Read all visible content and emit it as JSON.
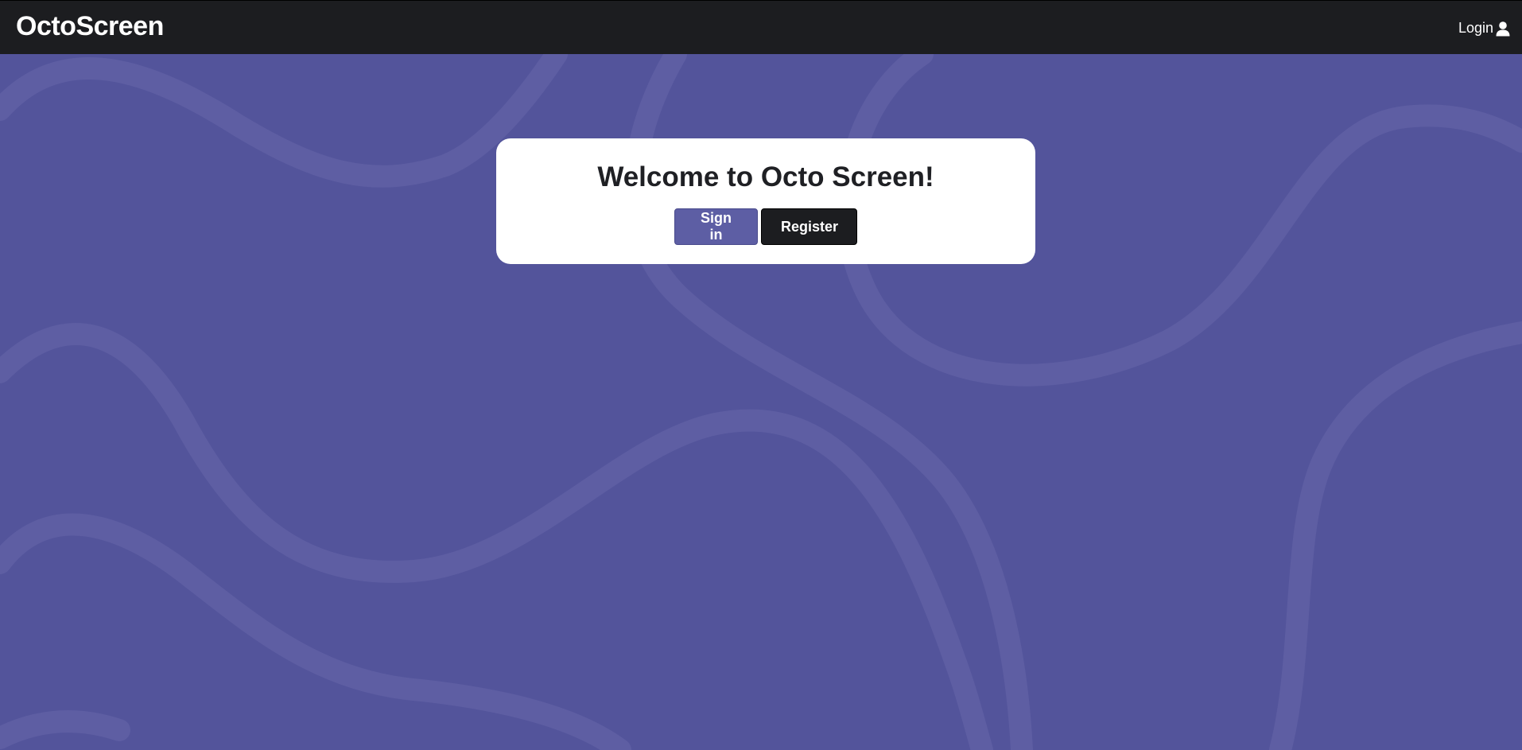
{
  "navbar": {
    "brand": "OctoScreen",
    "login_label": "Login",
    "login_icon": "user-icon"
  },
  "hero": {
    "background_color": "#53549b",
    "card": {
      "title": "Welcome to Octo Screen!",
      "signin_label": "Sign in",
      "register_label": "Register"
    }
  },
  "colors": {
    "navbar": "#1c1d20",
    "accent": "#5d5ea4",
    "dark_button": "#1c1d20"
  }
}
